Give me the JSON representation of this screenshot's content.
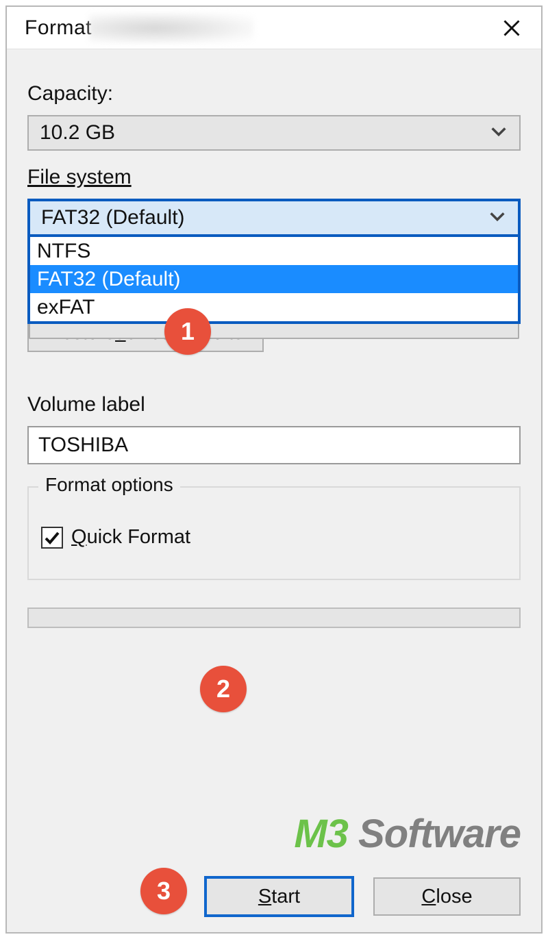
{
  "window": {
    "title": "Format"
  },
  "capacity": {
    "label": "Capacity:",
    "value": "10.2 GB"
  },
  "file_system": {
    "label": "File system",
    "selected": "FAT32 (Default)",
    "options": [
      "NTFS",
      "FAT32 (Default)",
      "exFAT"
    ]
  },
  "restore_defaults": {
    "pre": "Restore ",
    "uchar": "d",
    "post": "evice defaults"
  },
  "volume_label": {
    "label": "Volume label",
    "value": "TOSHIBA"
  },
  "format_options": {
    "legend": "Format options",
    "quick_format": {
      "pre": "",
      "uchar": "Q",
      "post": "uick Format",
      "checked": true
    }
  },
  "buttons": {
    "start": {
      "uchar": "S",
      "post": "tart"
    },
    "close": {
      "uchar": "C",
      "post": "lose"
    }
  },
  "watermark": {
    "m": "M3",
    "s": " Software"
  },
  "annotations": {
    "b1": "1",
    "b2": "2",
    "b3": "3"
  }
}
